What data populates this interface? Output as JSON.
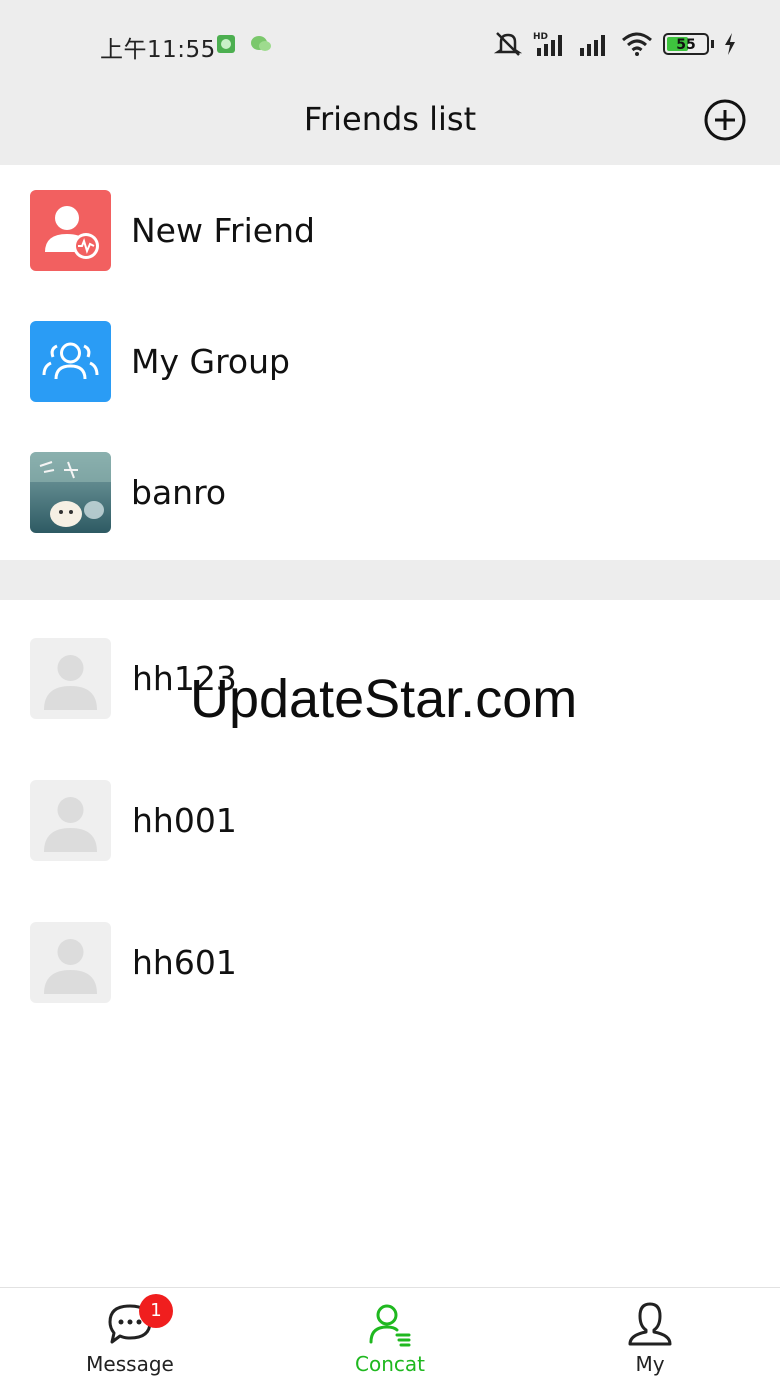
{
  "status_bar": {
    "time": "上午11:55",
    "battery_level": "55",
    "icons": [
      "app-icon",
      "wechat-icon",
      "mute-icon",
      "hd-signal-icon",
      "signal-icon",
      "wifi-icon",
      "battery-icon",
      "charging-icon"
    ]
  },
  "header": {
    "title": "Friends list",
    "add_icon": "plus-circle-icon"
  },
  "top_items": [
    {
      "label": "New Friend",
      "icon": "new-friend-icon",
      "color": "#f26060"
    },
    {
      "label": "My Group",
      "icon": "group-icon",
      "color": "#2a9cf5"
    },
    {
      "label": "banro",
      "icon": "profile-photo"
    }
  ],
  "friends": [
    {
      "label": "hh123",
      "icon": "default-avatar-icon"
    },
    {
      "label": "hh001",
      "icon": "default-avatar-icon"
    },
    {
      "label": "hh601",
      "icon": "default-avatar-icon"
    }
  ],
  "watermark": "UpdateStar.com",
  "tabs": [
    {
      "label": "Message",
      "icon": "chat-bubble-icon",
      "badge": "1",
      "active": false
    },
    {
      "label": "Concat",
      "icon": "contacts-icon",
      "active": true
    },
    {
      "label": "My",
      "icon": "user-icon",
      "active": false
    }
  ],
  "colors": {
    "accent": "#1fb81f",
    "badge": "#f01e1e",
    "header_bg": "#ededed"
  }
}
